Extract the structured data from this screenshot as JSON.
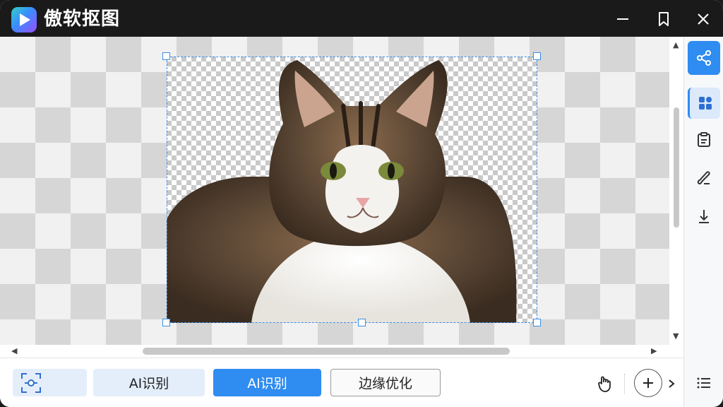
{
  "app": {
    "title": "傲软抠图"
  },
  "window_controls": {
    "icons": [
      "minimize-icon",
      "bookmark-icon",
      "close-icon"
    ]
  },
  "canvas": {
    "image_subject": "cat with transparent background",
    "selection_color": "#3a8ee6"
  },
  "toolbar": {
    "adjust_icon": "focus-adjust-icon",
    "ai_detect_light_label": "AI识别",
    "ai_detect_primary_label": "AI识别",
    "edge_refine_label": "边缘优化",
    "primary_color": "#2f8cf0"
  },
  "right_panel": {
    "icons": [
      "share-icon",
      "apps-grid-icon",
      "clipboard-icon",
      "brush-icon",
      "download-icon",
      "list-menu-icon"
    ],
    "accent": "#2f8cf0"
  }
}
